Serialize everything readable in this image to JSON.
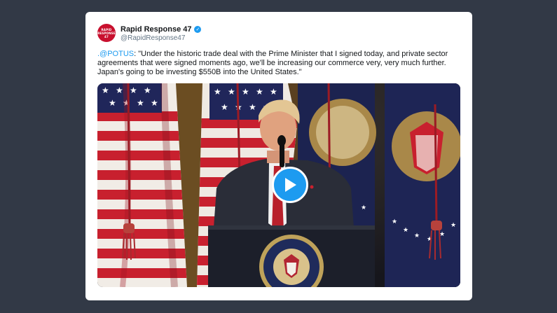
{
  "tweet": {
    "display_name": "Rapid Response 47",
    "handle": "@RapidResponse47",
    "avatar_text": "RAPID RESPONSE 47",
    "mention": ".@POTUS",
    "body": ": \"Under the historic trade deal with the Prime Minister that I signed today, and private sector agreements that were signed moments ago, we'll be increasing our commerce very, very much further. Japan's going to be investing $550B into the United States.\""
  },
  "media": {
    "type": "video",
    "play_icon": "play-icon"
  },
  "colors": {
    "background": "#323946",
    "card": "#ffffff",
    "link": "#1d9bf0",
    "verified": "#1d9bf0",
    "avatar": "#c8102e"
  }
}
